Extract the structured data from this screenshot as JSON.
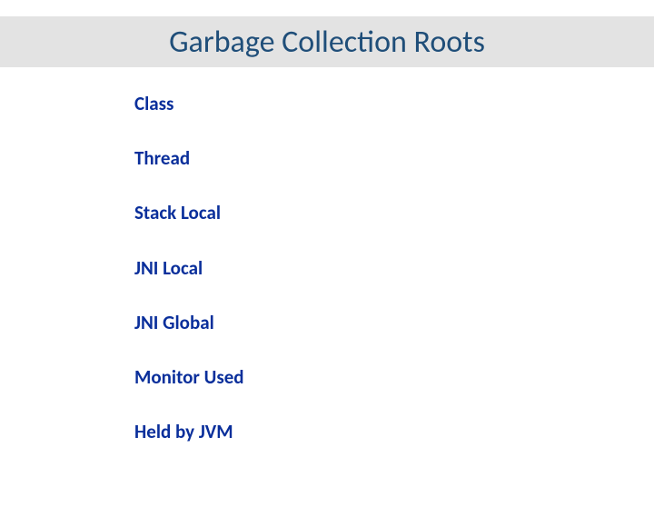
{
  "title": "Garbage Collection Roots",
  "items": [
    "Class",
    "Thread",
    "Stack Local",
    "JNI Local",
    "JNI Global",
    "Monitor Used",
    "Held by JVM"
  ]
}
